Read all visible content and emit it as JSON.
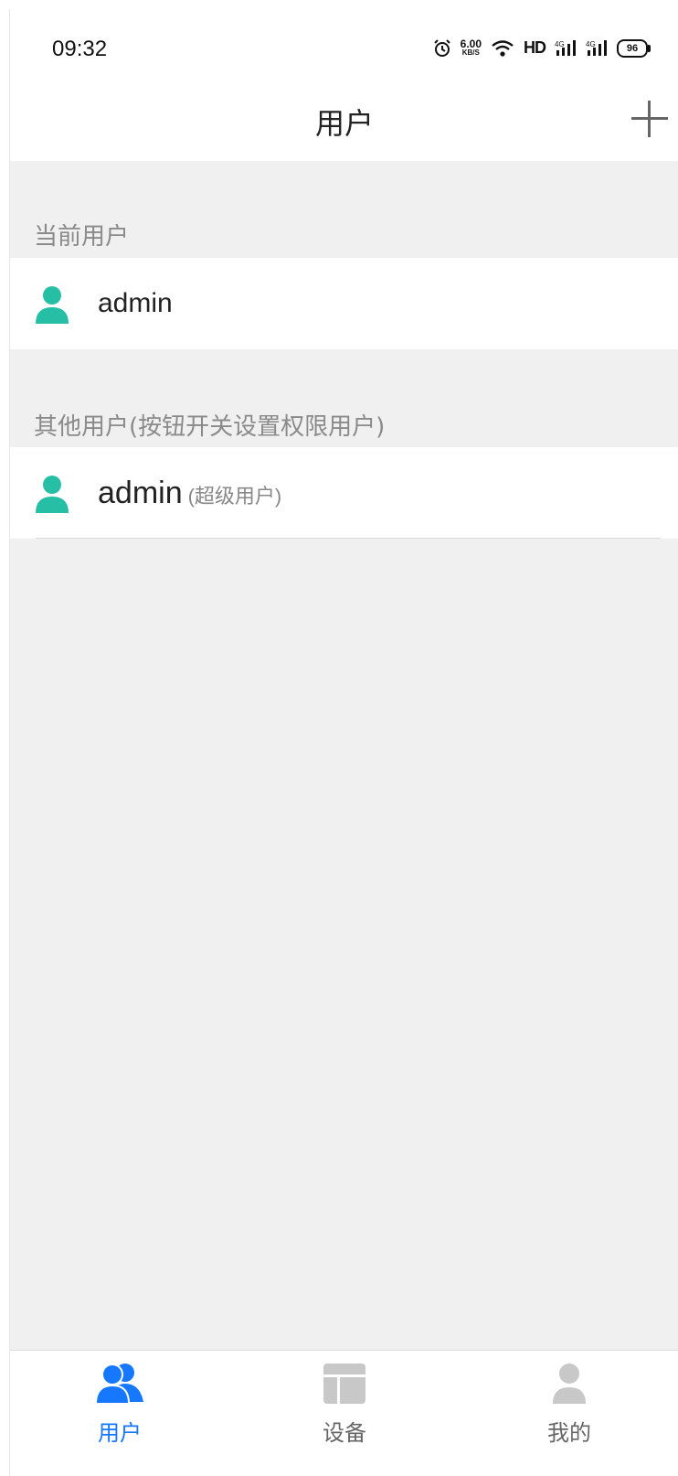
{
  "status_bar": {
    "time": "09:32",
    "speed_value": "6.00",
    "speed_unit": "KB/S",
    "hd_label": "HD",
    "battery": "96"
  },
  "header": {
    "title": "用户",
    "add_icon": "plus-icon"
  },
  "sections": {
    "current": {
      "title": "当前用户",
      "user": {
        "name": "admin",
        "icon": "user-icon"
      }
    },
    "others": {
      "title": "其他用户(按钮开关设置权限用户)",
      "users": [
        {
          "name": "admin",
          "role": "(超级用户)",
          "icon": "user-icon"
        }
      ]
    }
  },
  "tabbar": {
    "tabs": [
      {
        "label": "用户",
        "icon": "users-icon",
        "active": true
      },
      {
        "label": "设备",
        "icon": "device-icon",
        "active": false
      },
      {
        "label": "我的",
        "icon": "profile-icon",
        "active": false
      }
    ]
  },
  "colors": {
    "accent": "#1677ff",
    "avatar": "#26bfa5",
    "background": "#f0f0f0"
  }
}
